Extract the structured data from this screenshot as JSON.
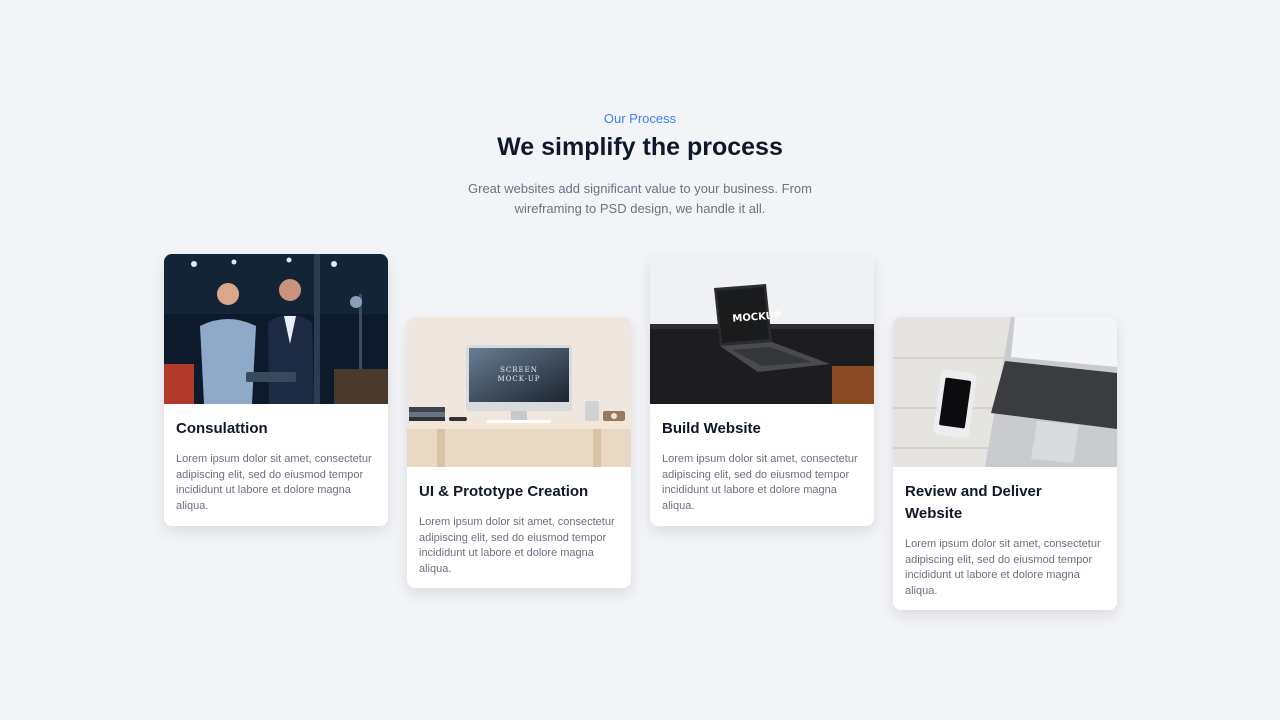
{
  "header": {
    "eyebrow": "Our Process",
    "title": "We simplify the process",
    "subtitle": "Great websites add significant value to your business. From wireframing to PSD design, we handle it all."
  },
  "cards": [
    {
      "title": "Consulattion",
      "text": "Lorem ipsum dolor sit amet, consectetur adipiscing elit, sed do eiusmod tempor incididunt ut labore et dolore magna aliqua."
    },
    {
      "title": "UI & Prototype Creation",
      "text": "Lorem ipsum dolor sit amet, consectetur adipiscing elit, sed do eiusmod tempor incididunt ut labore et dolore magna aliqua.",
      "image_text": [
        "SCREEN",
        "MOCK-UP"
      ]
    },
    {
      "title": "Build Website",
      "text": "Lorem ipsum dolor sit amet, consectetur adipiscing elit, sed do eiusmod tempor incididunt ut labore et dolore magna aliqua.",
      "image_text": "MOCKUP"
    },
    {
      "title": "Review and Deliver Website",
      "text": "Lorem ipsum dolor sit amet, consectetur adipiscing elit, sed do eiusmod tempor incididunt ut labore et dolore magna aliqua."
    }
  ],
  "colors": {
    "accent": "#3b82f6",
    "background": "#f2f4f7",
    "heading": "#0f172a",
    "muted": "#6b7280"
  }
}
